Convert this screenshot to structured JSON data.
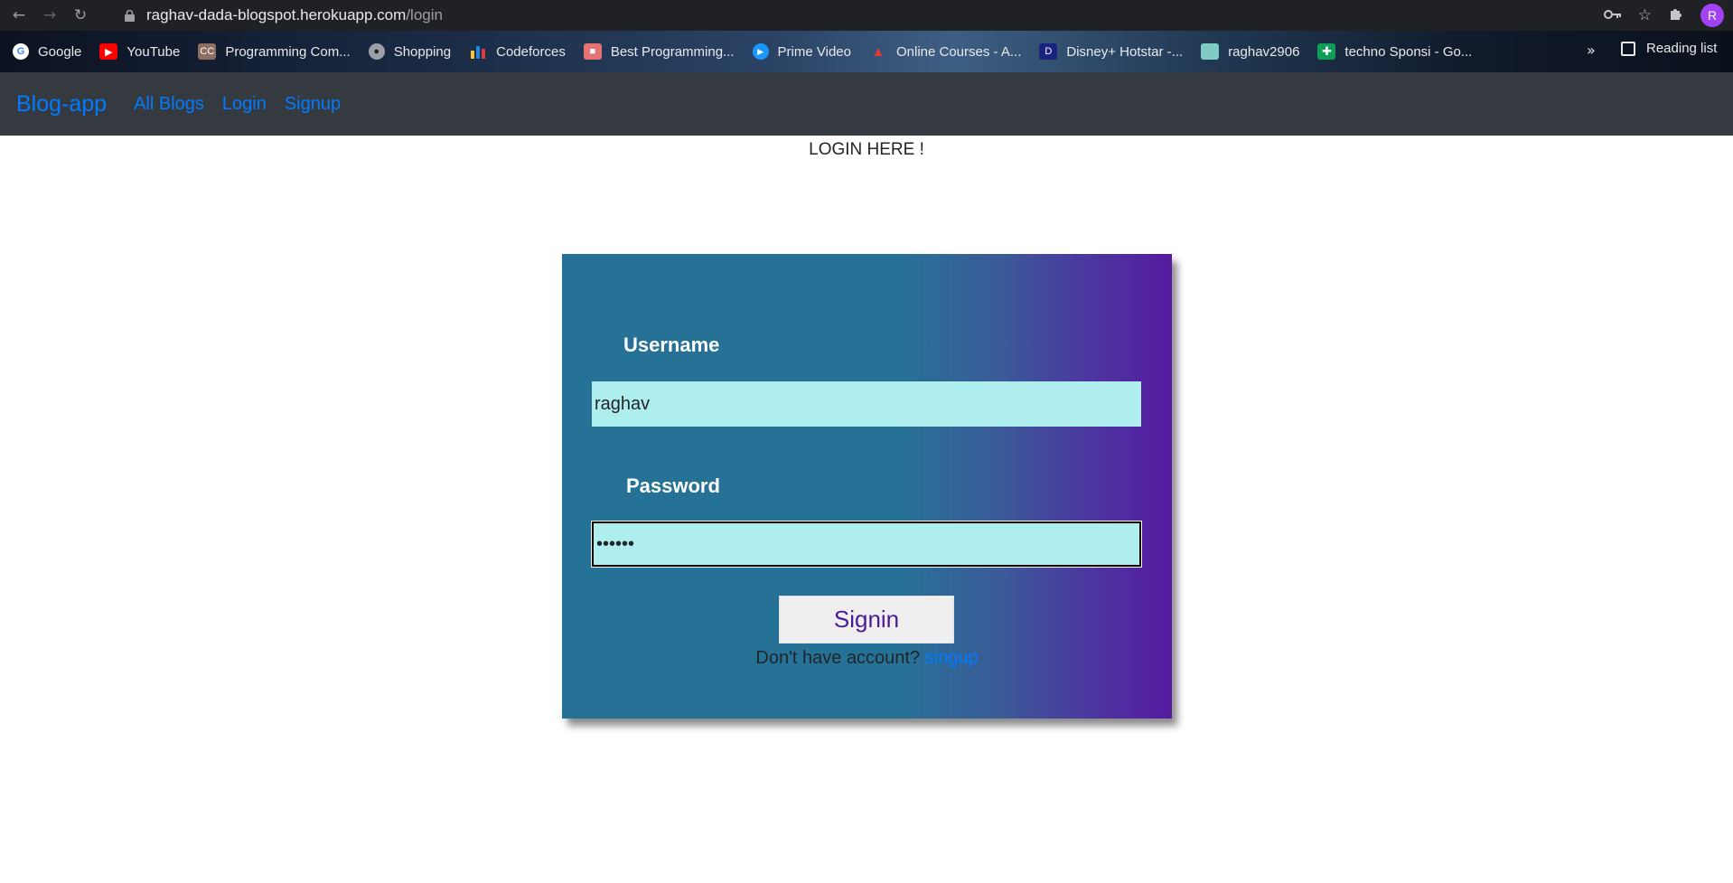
{
  "browser": {
    "url_host": "raghav-dada-blogspot.herokuapp.com",
    "url_path": "/login",
    "avatar_initial": "R",
    "bookmarks": [
      {
        "label": "Google",
        "icon": "google-icon",
        "color": "#4285f4"
      },
      {
        "label": "YouTube",
        "icon": "youtube-icon",
        "color": "#ff0000"
      },
      {
        "label": "Programming Com...",
        "icon": "cc-icon",
        "color": "#8d6e63"
      },
      {
        "label": "Shopping",
        "icon": "globe-icon",
        "color": "#9aa0a6"
      },
      {
        "label": "Codeforces",
        "icon": "codeforces-icon",
        "color": "#1e88e5"
      },
      {
        "label": "Best Programming...",
        "icon": "cube-icon",
        "color": "#e57373"
      },
      {
        "label": "Prime Video",
        "icon": "prime-video-icon",
        "color": "#1a98ff"
      },
      {
        "label": "Online Courses - A...",
        "icon": "coursera-icon",
        "color": "#e53935"
      },
      {
        "label": "Disney+ Hotstar -...",
        "icon": "hotstar-icon",
        "color": "#1a237e"
      },
      {
        "label": "raghav2906",
        "icon": "profile-image-icon",
        "color": "#80cbc4"
      },
      {
        "label": "techno Sponsi - Go...",
        "icon": "sheets-icon",
        "color": "#0f9d58"
      }
    ],
    "more_label": "»",
    "reading_list_label": "Reading list"
  },
  "app": {
    "brand": "Blog-app",
    "nav_links": [
      "All Blogs",
      "Login",
      "Signup"
    ]
  },
  "page": {
    "heading": "LOGIN HERE !",
    "username_label": "Username",
    "username_value": "raghav",
    "password_label": "Password",
    "password_value": "••••••",
    "signin_label": "Signin",
    "no_account_text": "Don't have account?",
    "signup_link": "singup"
  }
}
